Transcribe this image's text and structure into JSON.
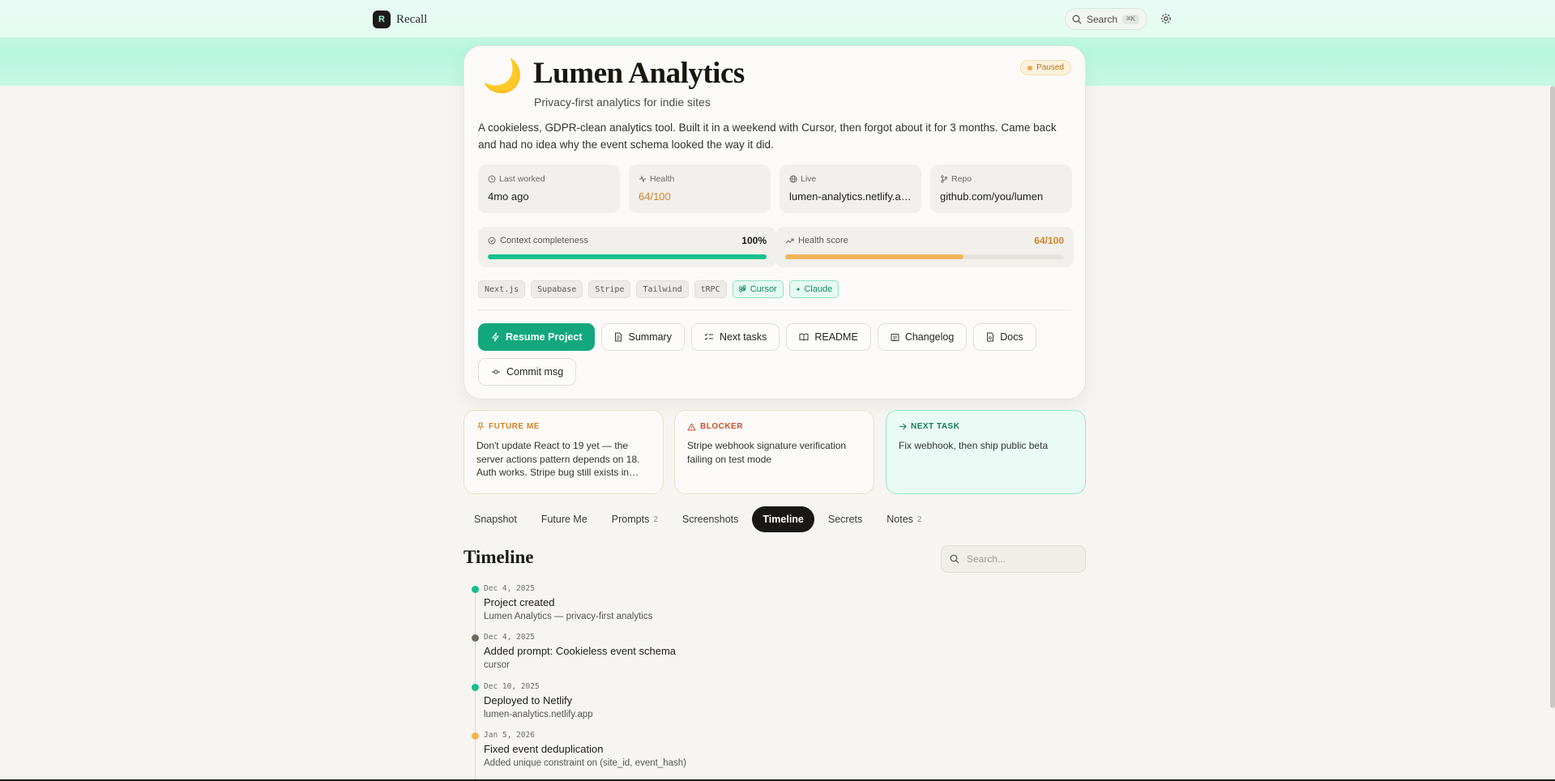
{
  "app": {
    "brand": "Recall",
    "logo_letter": "R"
  },
  "header": {
    "search_label": "Search",
    "search_shortcut": "⌘K",
    "settings_icon": "gear-icon"
  },
  "project": {
    "icon": "🌙",
    "name": "Lumen Analytics",
    "tagline": "Privacy-first analytics for indie sites",
    "status": "Paused",
    "status_color": "#f0a848",
    "description": "A cookieless, GDPR-clean analytics tool. Built it in a weekend with Cursor, then forgot about it for 3 months. Came back and had no idea why the event schema looked the way it did."
  },
  "stats": [
    {
      "label": "Last worked",
      "value": "4mo ago",
      "icon": "clock-icon",
      "color": "#1e1d1a"
    },
    {
      "label": "Health",
      "value": "64/100",
      "icon": "pulse-icon",
      "color": "#d3832a"
    },
    {
      "label": "Live",
      "value": "lumen-analytics.netlify.app",
      "icon": "globe-icon",
      "color": "#1e1d1a"
    },
    {
      "label": "Repo",
      "value": "github.com/you/lumen",
      "icon": "branch-icon",
      "color": "#1e1d1a"
    }
  ],
  "meters": {
    "context": {
      "label": "Context completeness",
      "value_text": "100%",
      "fraction": 1.0,
      "color": "#14c28d"
    },
    "health": {
      "label": "Health score",
      "value_text": "64/100",
      "fraction": 0.64,
      "color": "#f4b55a"
    }
  },
  "tags": [
    "Next.js",
    "Supabase",
    "Stripe",
    "Tailwind",
    "tRPC"
  ],
  "ai_tags": [
    {
      "label": "Cursor",
      "icon": "command-icon"
    },
    {
      "label": "Claude",
      "icon": "sparkle-icon"
    }
  ],
  "actions": {
    "resume": "Resume Project",
    "summary": "Summary",
    "next_tasks": "Next tasks",
    "readme": "README",
    "changelog": "Changelog",
    "docs": "Docs",
    "commit_msg": "Commit msg"
  },
  "notes": {
    "future_me": {
      "label": "FUTURE ME",
      "text": "Don't update React to 19 yet — the server actions pattern depends on 18. Auth works. Stripe bug still exists in…",
      "color": "#d3832a"
    },
    "blocker": {
      "label": "BLOCKER",
      "text": "Stripe webhook signature verification failing on test mode",
      "color": "#c9532e"
    },
    "next_task": {
      "label": "NEXT TASK",
      "text": "Fix webhook, then ship public beta",
      "color": "#137a5a"
    }
  },
  "tabs": [
    {
      "label": "Snapshot",
      "count": ""
    },
    {
      "label": "Future Me",
      "count": ""
    },
    {
      "label": "Prompts",
      "count": "2"
    },
    {
      "label": "Screenshots",
      "count": ""
    },
    {
      "label": "Timeline",
      "count": "",
      "active": true
    },
    {
      "label": "Secrets",
      "count": ""
    },
    {
      "label": "Notes",
      "count": "2"
    }
  ],
  "timeline": {
    "title": "Timeline",
    "search_placeholder": "Search...",
    "items": [
      {
        "date": "Dec 4, 2025",
        "title": "Project created",
        "detail": "Lumen Analytics — privacy-first analytics",
        "color": "#17bf89"
      },
      {
        "date": "Dec 4, 2025",
        "title": "Added prompt: Cookieless event schema",
        "detail": "cursor",
        "color": "#6e6a60"
      },
      {
        "date": "Dec 10, 2025",
        "title": "Deployed to Netlify",
        "detail": "lumen-analytics.netlify.app",
        "color": "#17bf89"
      },
      {
        "date": "Jan 5, 2026",
        "title": "Fixed event deduplication",
        "detail": "Added unique constraint on (site_id, event_hash)",
        "color": "#f4b55a"
      }
    ]
  }
}
